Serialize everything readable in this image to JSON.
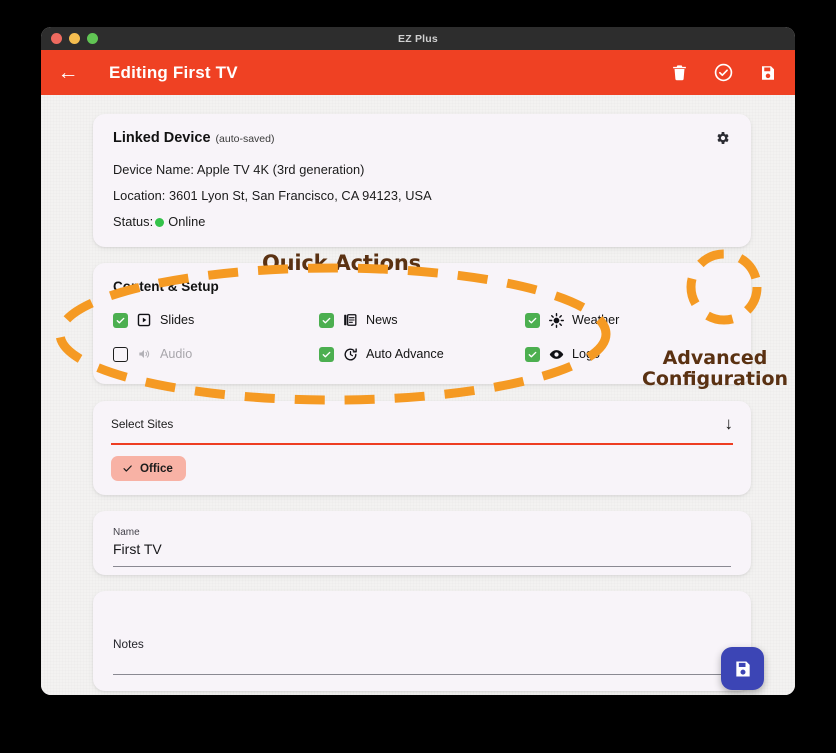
{
  "window": {
    "title": "EZ Plus",
    "traffic_lights": [
      "close-red",
      "minimize-yellow",
      "zoom-green"
    ]
  },
  "appbar": {
    "back_icon": "back-arrow-icon",
    "title": "Editing First TV",
    "actions": [
      {
        "name": "delete-button",
        "icon": "trash-icon"
      },
      {
        "name": "confirm-button",
        "icon": "check-circle-icon"
      },
      {
        "name": "save-button",
        "icon": "save-disk-icon"
      }
    ],
    "color": "#ef4123"
  },
  "device_card": {
    "title": "Linked Device",
    "subtitle": "(auto-saved)",
    "settings_icon": "gear-icon",
    "device_name_line": "Device Name: Apple TV 4K (3rd generation)",
    "location_line": "Location: 3601 Lyon St, San Francisco, CA 94123, USA",
    "status_prefix": "Status:",
    "status_value": "Online",
    "status_color": "#34c24a"
  },
  "content_card": {
    "title": "Content & Setup",
    "items": [
      {
        "label": "Slides",
        "checked": true,
        "icon": "play-box-icon",
        "disabled": false
      },
      {
        "label": "News",
        "checked": true,
        "icon": "news-icon",
        "disabled": false
      },
      {
        "label": "Weather",
        "checked": true,
        "icon": "sun-icon",
        "disabled": false
      },
      {
        "label": "Audio",
        "checked": false,
        "icon": "speaker-icon",
        "disabled": true
      },
      {
        "label": "Auto Advance",
        "checked": true,
        "icon": "timer-icon",
        "disabled": false
      },
      {
        "label": "Logo",
        "checked": true,
        "icon": "eye-icon",
        "disabled": false
      }
    ],
    "checked_color": "#4caf50"
  },
  "sites_card": {
    "label": "Select Sites",
    "dropdown_icon": "arrow-down-icon",
    "underline_color": "#ee3d22",
    "chips": [
      {
        "label": "Office",
        "icon": "check-icon",
        "color": "#f8b2a5"
      }
    ]
  },
  "name_field": {
    "label": "Name",
    "value": "First TV"
  },
  "notes_field": {
    "label": "Notes",
    "value": ""
  },
  "fab": {
    "icon": "save-disk-icon",
    "color": "#3c45b5"
  },
  "annotations": [
    {
      "id": "quick-actions",
      "text": "Quick Actions",
      "shape": "dashed-ellipse",
      "color": "#f59a23"
    },
    {
      "id": "advanced-configuration",
      "text": "Advanced\nConfiguration",
      "shape": "dashed-circle",
      "color": "#f59a23"
    }
  ]
}
